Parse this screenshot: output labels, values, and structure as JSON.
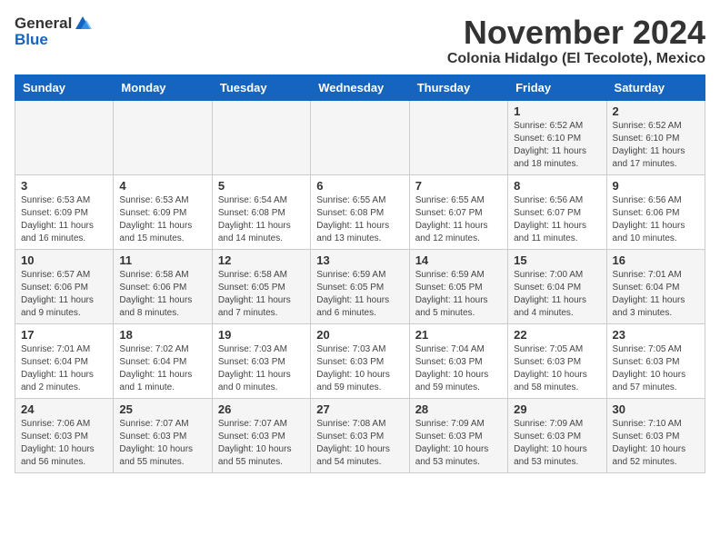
{
  "header": {
    "logo_line1": "General",
    "logo_line2": "Blue",
    "month_title": "November 2024",
    "subtitle": "Colonia Hidalgo (El Tecolote), Mexico"
  },
  "weekdays": [
    "Sunday",
    "Monday",
    "Tuesday",
    "Wednesday",
    "Thursday",
    "Friday",
    "Saturday"
  ],
  "weeks": [
    [
      {
        "day": "",
        "info": ""
      },
      {
        "day": "",
        "info": ""
      },
      {
        "day": "",
        "info": ""
      },
      {
        "day": "",
        "info": ""
      },
      {
        "day": "",
        "info": ""
      },
      {
        "day": "1",
        "info": "Sunrise: 6:52 AM\nSunset: 6:10 PM\nDaylight: 11 hours and 18 minutes."
      },
      {
        "day": "2",
        "info": "Sunrise: 6:52 AM\nSunset: 6:10 PM\nDaylight: 11 hours and 17 minutes."
      }
    ],
    [
      {
        "day": "3",
        "info": "Sunrise: 6:53 AM\nSunset: 6:09 PM\nDaylight: 11 hours and 16 minutes."
      },
      {
        "day": "4",
        "info": "Sunrise: 6:53 AM\nSunset: 6:09 PM\nDaylight: 11 hours and 15 minutes."
      },
      {
        "day": "5",
        "info": "Sunrise: 6:54 AM\nSunset: 6:08 PM\nDaylight: 11 hours and 14 minutes."
      },
      {
        "day": "6",
        "info": "Sunrise: 6:55 AM\nSunset: 6:08 PM\nDaylight: 11 hours and 13 minutes."
      },
      {
        "day": "7",
        "info": "Sunrise: 6:55 AM\nSunset: 6:07 PM\nDaylight: 11 hours and 12 minutes."
      },
      {
        "day": "8",
        "info": "Sunrise: 6:56 AM\nSunset: 6:07 PM\nDaylight: 11 hours and 11 minutes."
      },
      {
        "day": "9",
        "info": "Sunrise: 6:56 AM\nSunset: 6:06 PM\nDaylight: 11 hours and 10 minutes."
      }
    ],
    [
      {
        "day": "10",
        "info": "Sunrise: 6:57 AM\nSunset: 6:06 PM\nDaylight: 11 hours and 9 minutes."
      },
      {
        "day": "11",
        "info": "Sunrise: 6:58 AM\nSunset: 6:06 PM\nDaylight: 11 hours and 8 minutes."
      },
      {
        "day": "12",
        "info": "Sunrise: 6:58 AM\nSunset: 6:05 PM\nDaylight: 11 hours and 7 minutes."
      },
      {
        "day": "13",
        "info": "Sunrise: 6:59 AM\nSunset: 6:05 PM\nDaylight: 11 hours and 6 minutes."
      },
      {
        "day": "14",
        "info": "Sunrise: 6:59 AM\nSunset: 6:05 PM\nDaylight: 11 hours and 5 minutes."
      },
      {
        "day": "15",
        "info": "Sunrise: 7:00 AM\nSunset: 6:04 PM\nDaylight: 11 hours and 4 minutes."
      },
      {
        "day": "16",
        "info": "Sunrise: 7:01 AM\nSunset: 6:04 PM\nDaylight: 11 hours and 3 minutes."
      }
    ],
    [
      {
        "day": "17",
        "info": "Sunrise: 7:01 AM\nSunset: 6:04 PM\nDaylight: 11 hours and 2 minutes."
      },
      {
        "day": "18",
        "info": "Sunrise: 7:02 AM\nSunset: 6:04 PM\nDaylight: 11 hours and 1 minute."
      },
      {
        "day": "19",
        "info": "Sunrise: 7:03 AM\nSunset: 6:03 PM\nDaylight: 11 hours and 0 minutes."
      },
      {
        "day": "20",
        "info": "Sunrise: 7:03 AM\nSunset: 6:03 PM\nDaylight: 10 hours and 59 minutes."
      },
      {
        "day": "21",
        "info": "Sunrise: 7:04 AM\nSunset: 6:03 PM\nDaylight: 10 hours and 59 minutes."
      },
      {
        "day": "22",
        "info": "Sunrise: 7:05 AM\nSunset: 6:03 PM\nDaylight: 10 hours and 58 minutes."
      },
      {
        "day": "23",
        "info": "Sunrise: 7:05 AM\nSunset: 6:03 PM\nDaylight: 10 hours and 57 minutes."
      }
    ],
    [
      {
        "day": "24",
        "info": "Sunrise: 7:06 AM\nSunset: 6:03 PM\nDaylight: 10 hours and 56 minutes."
      },
      {
        "day": "25",
        "info": "Sunrise: 7:07 AM\nSunset: 6:03 PM\nDaylight: 10 hours and 55 minutes."
      },
      {
        "day": "26",
        "info": "Sunrise: 7:07 AM\nSunset: 6:03 PM\nDaylight: 10 hours and 55 minutes."
      },
      {
        "day": "27",
        "info": "Sunrise: 7:08 AM\nSunset: 6:03 PM\nDaylight: 10 hours and 54 minutes."
      },
      {
        "day": "28",
        "info": "Sunrise: 7:09 AM\nSunset: 6:03 PM\nDaylight: 10 hours and 53 minutes."
      },
      {
        "day": "29",
        "info": "Sunrise: 7:09 AM\nSunset: 6:03 PM\nDaylight: 10 hours and 53 minutes."
      },
      {
        "day": "30",
        "info": "Sunrise: 7:10 AM\nSunset: 6:03 PM\nDaylight: 10 hours and 52 minutes."
      }
    ]
  ]
}
